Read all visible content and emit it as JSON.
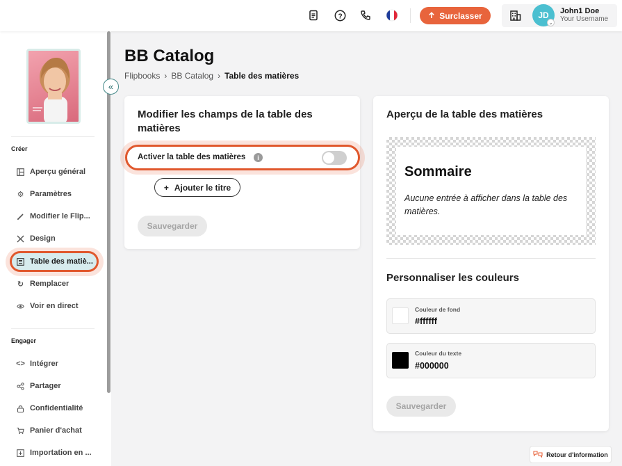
{
  "topbar": {
    "icons": [
      "document-icon",
      "help-icon",
      "phone-icon",
      "flag-fr-icon",
      "building-icon"
    ],
    "upgrade_label": "Surclasser",
    "user": {
      "initials": "JD",
      "name": "John1 Doe",
      "username": "Your Username"
    }
  },
  "sidebar": {
    "section_create": "Créer",
    "section_engage": "Engager",
    "items_create": [
      {
        "label": "Aperçu général",
        "icon": "layout-icon"
      },
      {
        "label": "Paramètres",
        "icon": "gear-icon"
      },
      {
        "label": "Modifier le Flip...",
        "icon": "pencil-icon"
      },
      {
        "label": "Design",
        "icon": "design-tools-icon"
      },
      {
        "label": "Table des matiè...",
        "icon": "list-icon",
        "active": true
      },
      {
        "label": "Remplacer",
        "icon": "refresh-icon"
      },
      {
        "label": "Voir en direct",
        "icon": "eye-icon"
      }
    ],
    "items_engage": [
      {
        "label": "Intégrer",
        "icon": "code-icon"
      },
      {
        "label": "Partager",
        "icon": "share-icon"
      },
      {
        "label": "Confidentialité",
        "icon": "lock-icon"
      },
      {
        "label": "Panier d'achat",
        "icon": "cart-icon"
      },
      {
        "label": "Importation en ...",
        "icon": "import-icon"
      }
    ]
  },
  "page": {
    "title": "BB Catalog",
    "breadcrumb": [
      "Flipbooks",
      "BB Catalog",
      "Table des matières"
    ]
  },
  "edit_card": {
    "heading": "Modifier les champs de la table des matières",
    "toggle_label": "Activer la table des matières",
    "toggle_on": false,
    "add_title_label": "Ajouter le titre",
    "save_label": "Sauvegarder"
  },
  "preview_card": {
    "heading": "Aperçu de la table des matières",
    "preview_title": "Sommaire",
    "empty_message": "Aucune entrée à afficher dans la table des matières.",
    "colors_heading": "Personnaliser les couleurs",
    "background_label": "Couleur de fond",
    "background_value": "#ffffff",
    "text_label": "Couleur du texte",
    "text_value": "#000000",
    "save_label": "Sauvegarder"
  },
  "feedback_label": "Retour d'information",
  "colors": {
    "accent": "#e8643c",
    "active_bg": "#d7ecee",
    "avatar": "#4bbfd0"
  }
}
